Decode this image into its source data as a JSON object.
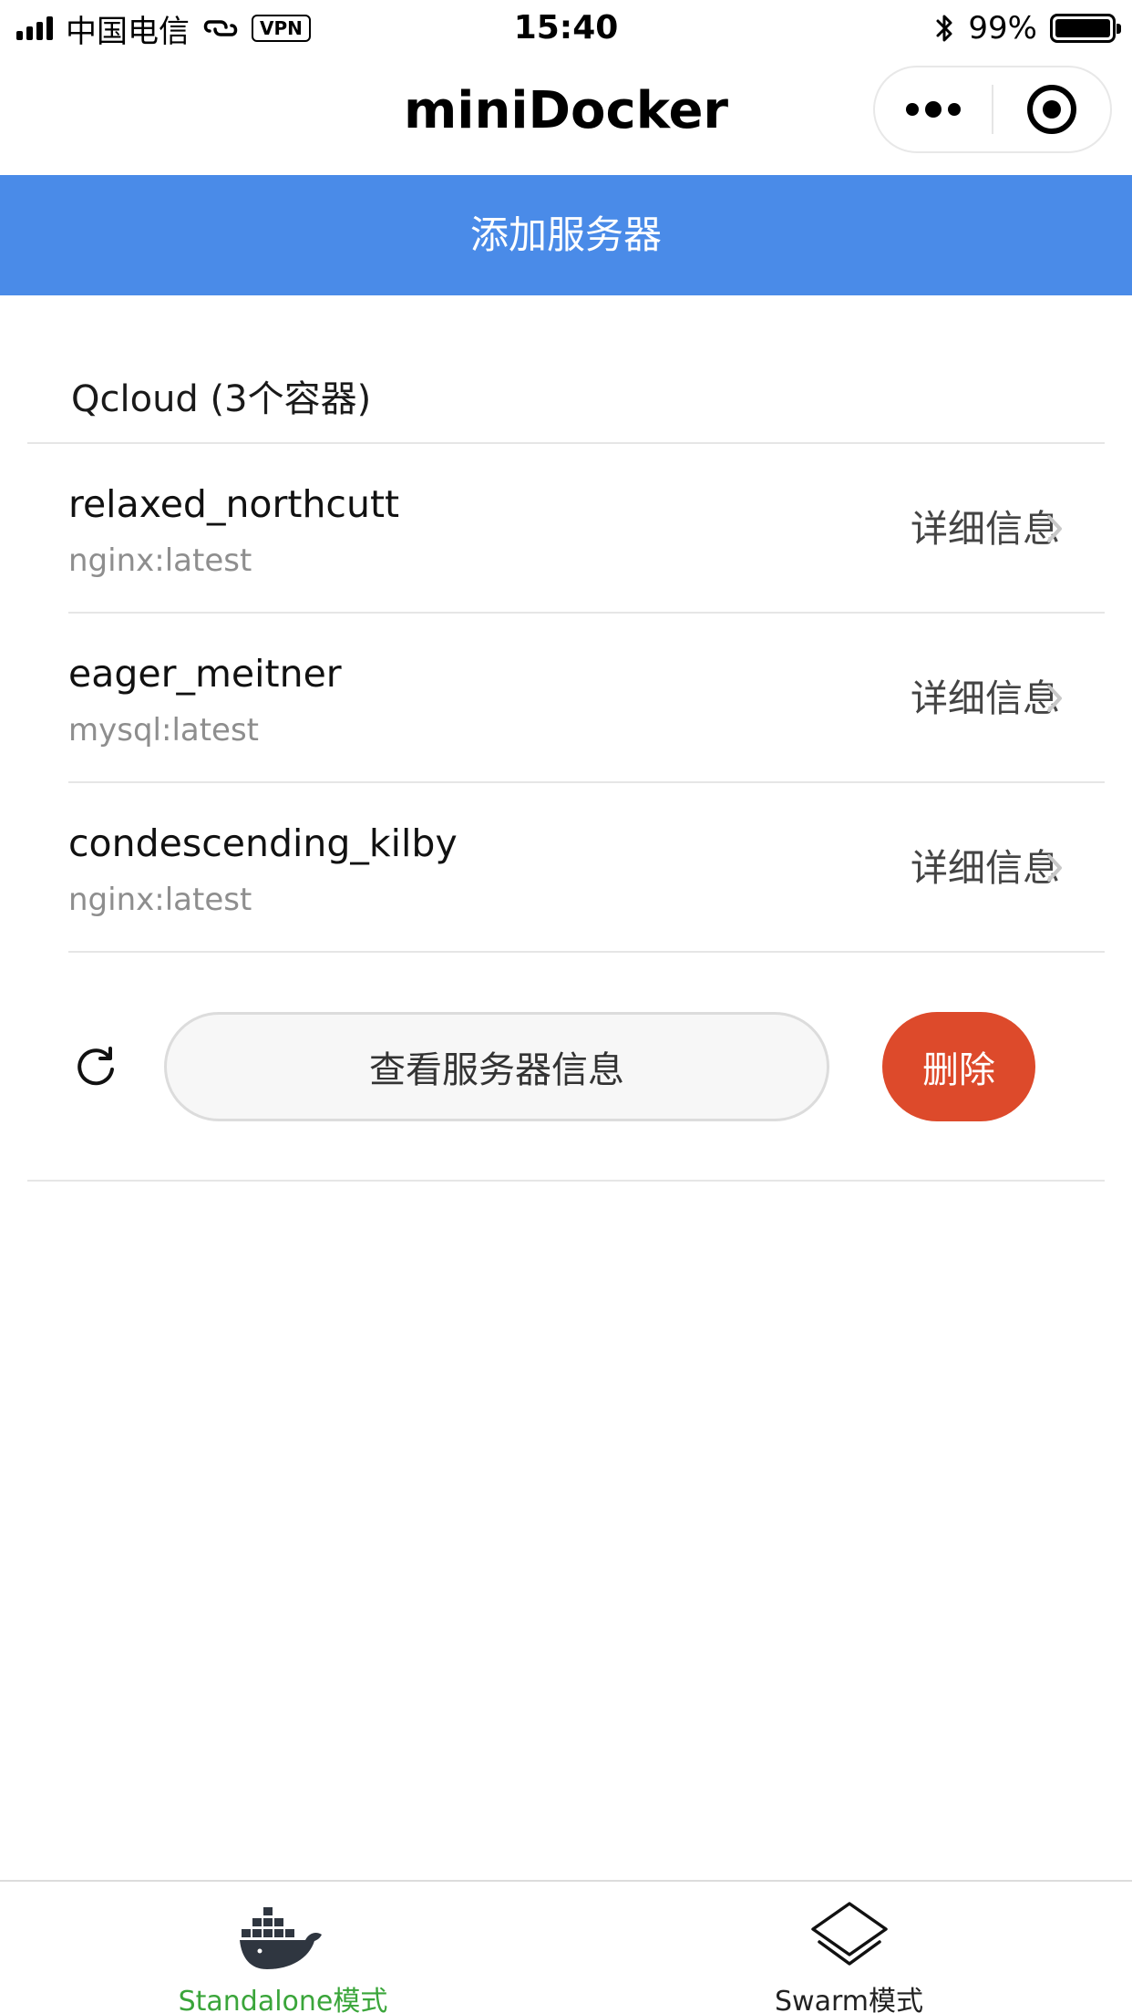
{
  "status_bar": {
    "carrier": "中国电信",
    "vpn": "VPN",
    "time": "15:40",
    "battery": "99%"
  },
  "nav": {
    "title": "miniDocker"
  },
  "add_server": {
    "label": "添加服务器"
  },
  "server": {
    "header": "Qcloud (3个容器)",
    "containers": [
      {
        "name": "relaxed_northcutt",
        "image": "nginx:latest",
        "detail": "详细信息"
      },
      {
        "name": "eager_meitner",
        "image": "mysql:latest",
        "detail": "详细信息"
      },
      {
        "name": "condescending_kilby",
        "image": "nginx:latest",
        "detail": "详细信息"
      }
    ],
    "view_info_label": "查看服务器信息",
    "delete_label": "删除"
  },
  "tabbar": {
    "tabs": [
      {
        "label": "Standalone模式",
        "icon": "docker-whale-icon",
        "active": true
      },
      {
        "label": "Swarm模式",
        "icon": "layers-icon",
        "active": false
      }
    ]
  },
  "colors": {
    "primary": "#4a8be8",
    "danger": "#dd4a2b",
    "active_tab": "#3aa53a"
  }
}
